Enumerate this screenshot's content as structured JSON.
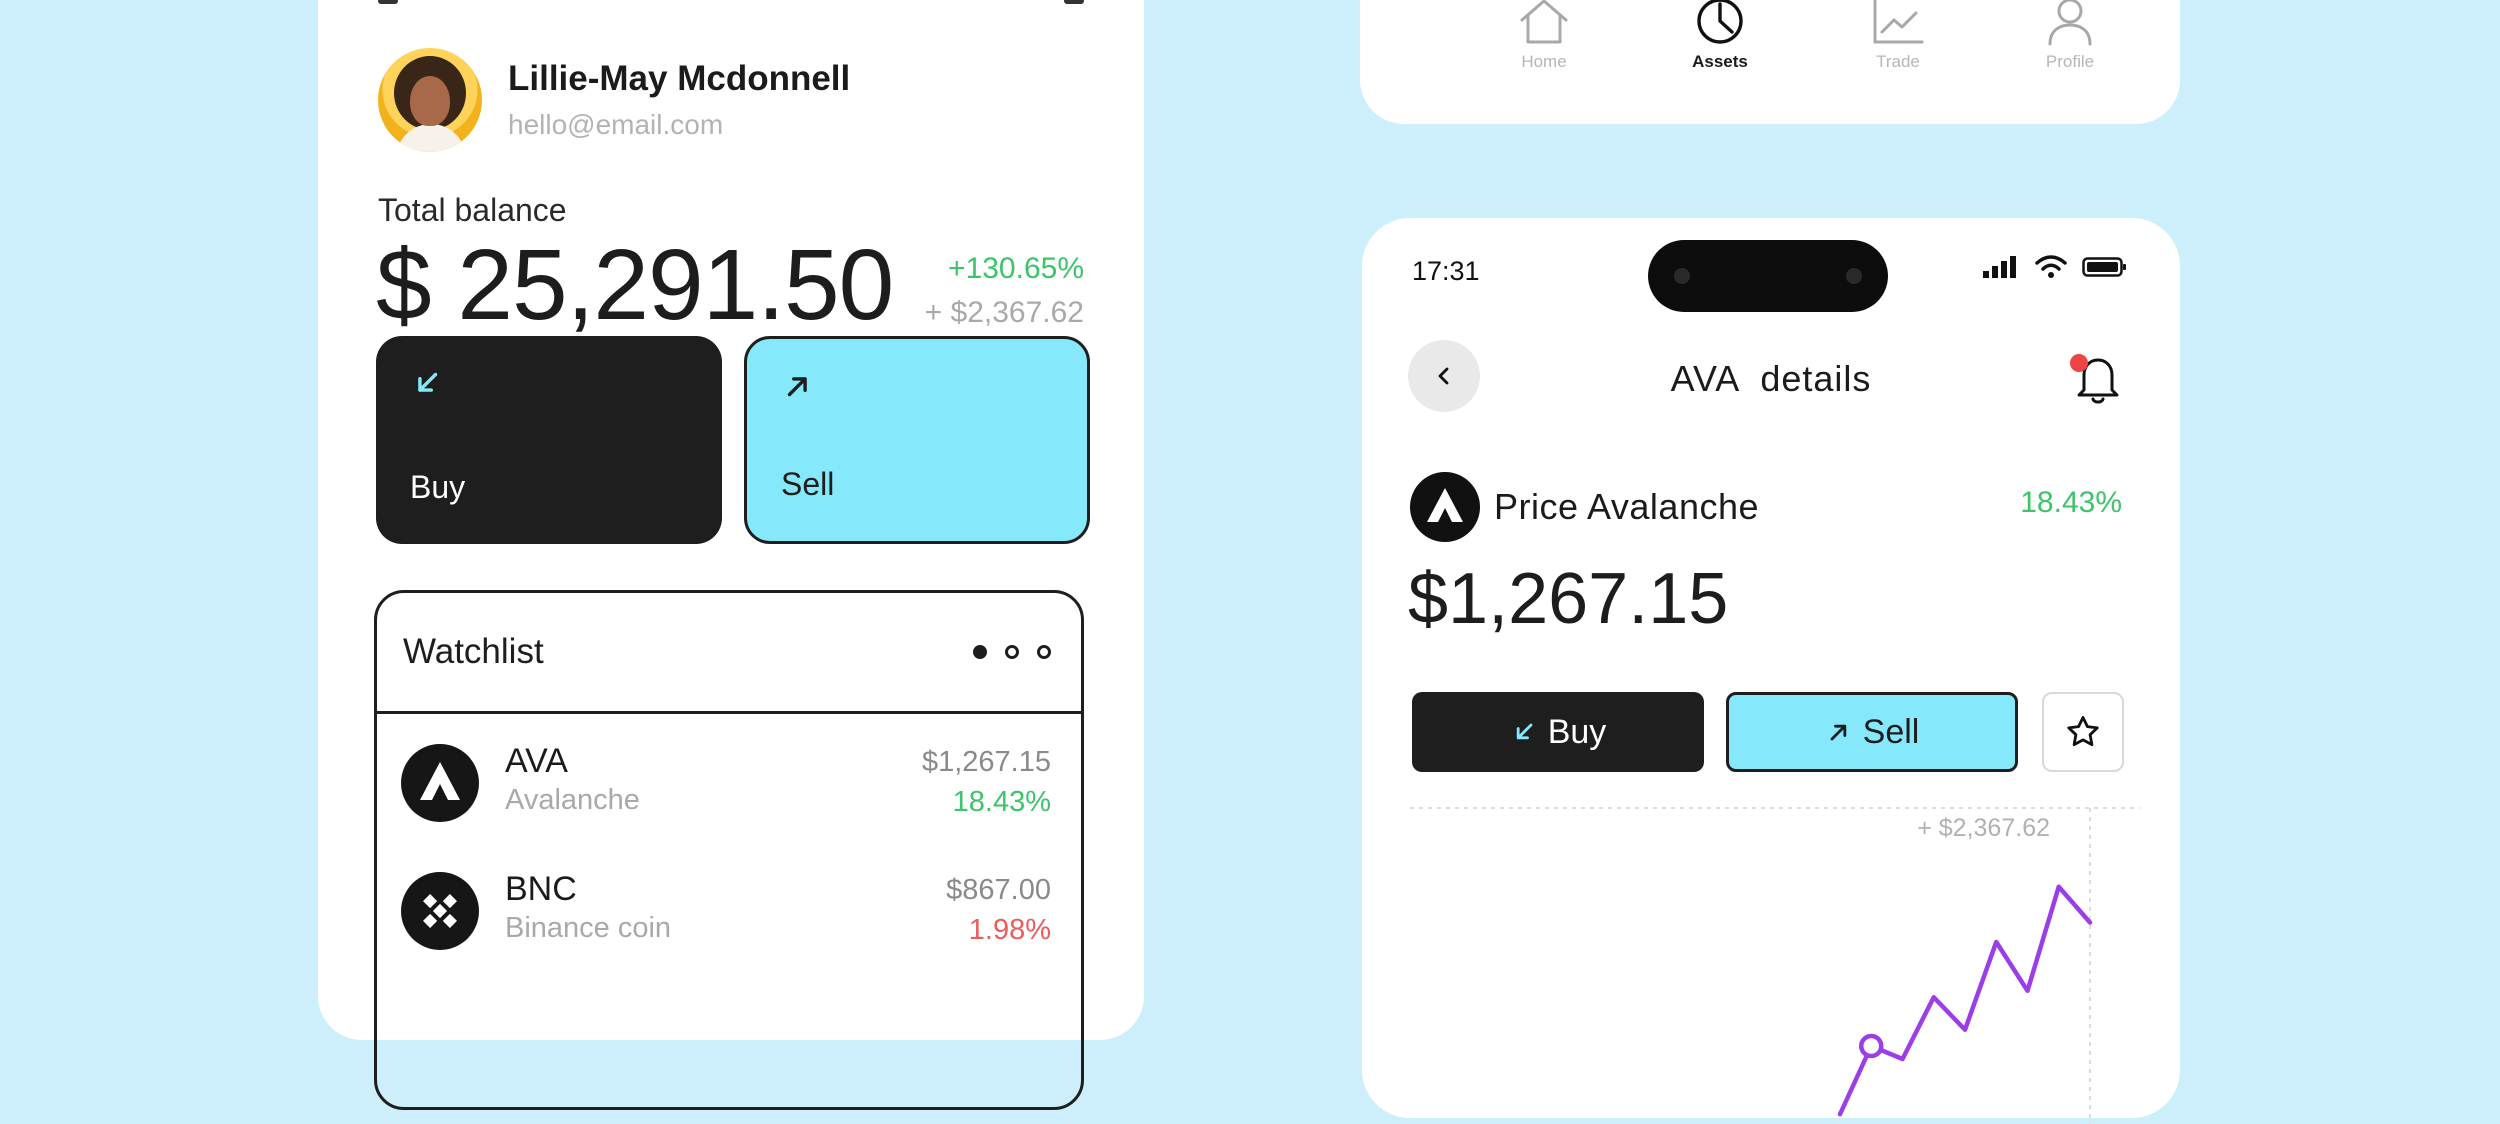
{
  "colors": {
    "background": "#cdeefb",
    "accent_cyan": "#86e8fb",
    "dark": "#1e1e1e",
    "positive": "#3cc46a",
    "negative": "#ef5a5a",
    "chart_line": "#9b3ee8"
  },
  "profile": {
    "name": "Lillie-May Mcdonnell",
    "email": "hello@email.com"
  },
  "balance": {
    "label": "Total balance",
    "amount": "$ 25,291.50",
    "change_pct": "+130.65%",
    "change_abs": "+ $2,367.62"
  },
  "actions": {
    "buy_label": "Buy",
    "sell_label": "Sell"
  },
  "watchlist": {
    "title": "Watchlist",
    "items": [
      {
        "symbol": "AVA",
        "name": "Avalanche",
        "price": "$1,267.15",
        "change": "18.43%",
        "direction": "up",
        "icon": "avalanche-logo"
      },
      {
        "symbol": "BNC",
        "name": "Binance coin",
        "price": "$867.00",
        "change": "1.98%",
        "direction": "down",
        "icon": "binance-logo"
      }
    ]
  },
  "bottom_nav": {
    "items": [
      {
        "label": "Home",
        "icon": "home-icon",
        "active": false
      },
      {
        "label": "Assets",
        "icon": "pie-chart-icon",
        "active": true
      },
      {
        "label": "Trade",
        "icon": "trend-chart-icon",
        "active": false
      },
      {
        "label": "Profile",
        "icon": "user-icon",
        "active": false
      }
    ]
  },
  "details": {
    "status_time": "17:31",
    "title": "AVA  details",
    "price_label": "Price Avalanche",
    "price_change": "18.43%",
    "price": "$1,267.15",
    "buy_label": "Buy",
    "sell_label": "Sell",
    "chart_delta": "+ $2,367.62",
    "chart_points": [
      0.3,
      2.4,
      2.0,
      3.9,
      2.9,
      5.6,
      4.1,
      7.3,
      6.2
    ]
  }
}
